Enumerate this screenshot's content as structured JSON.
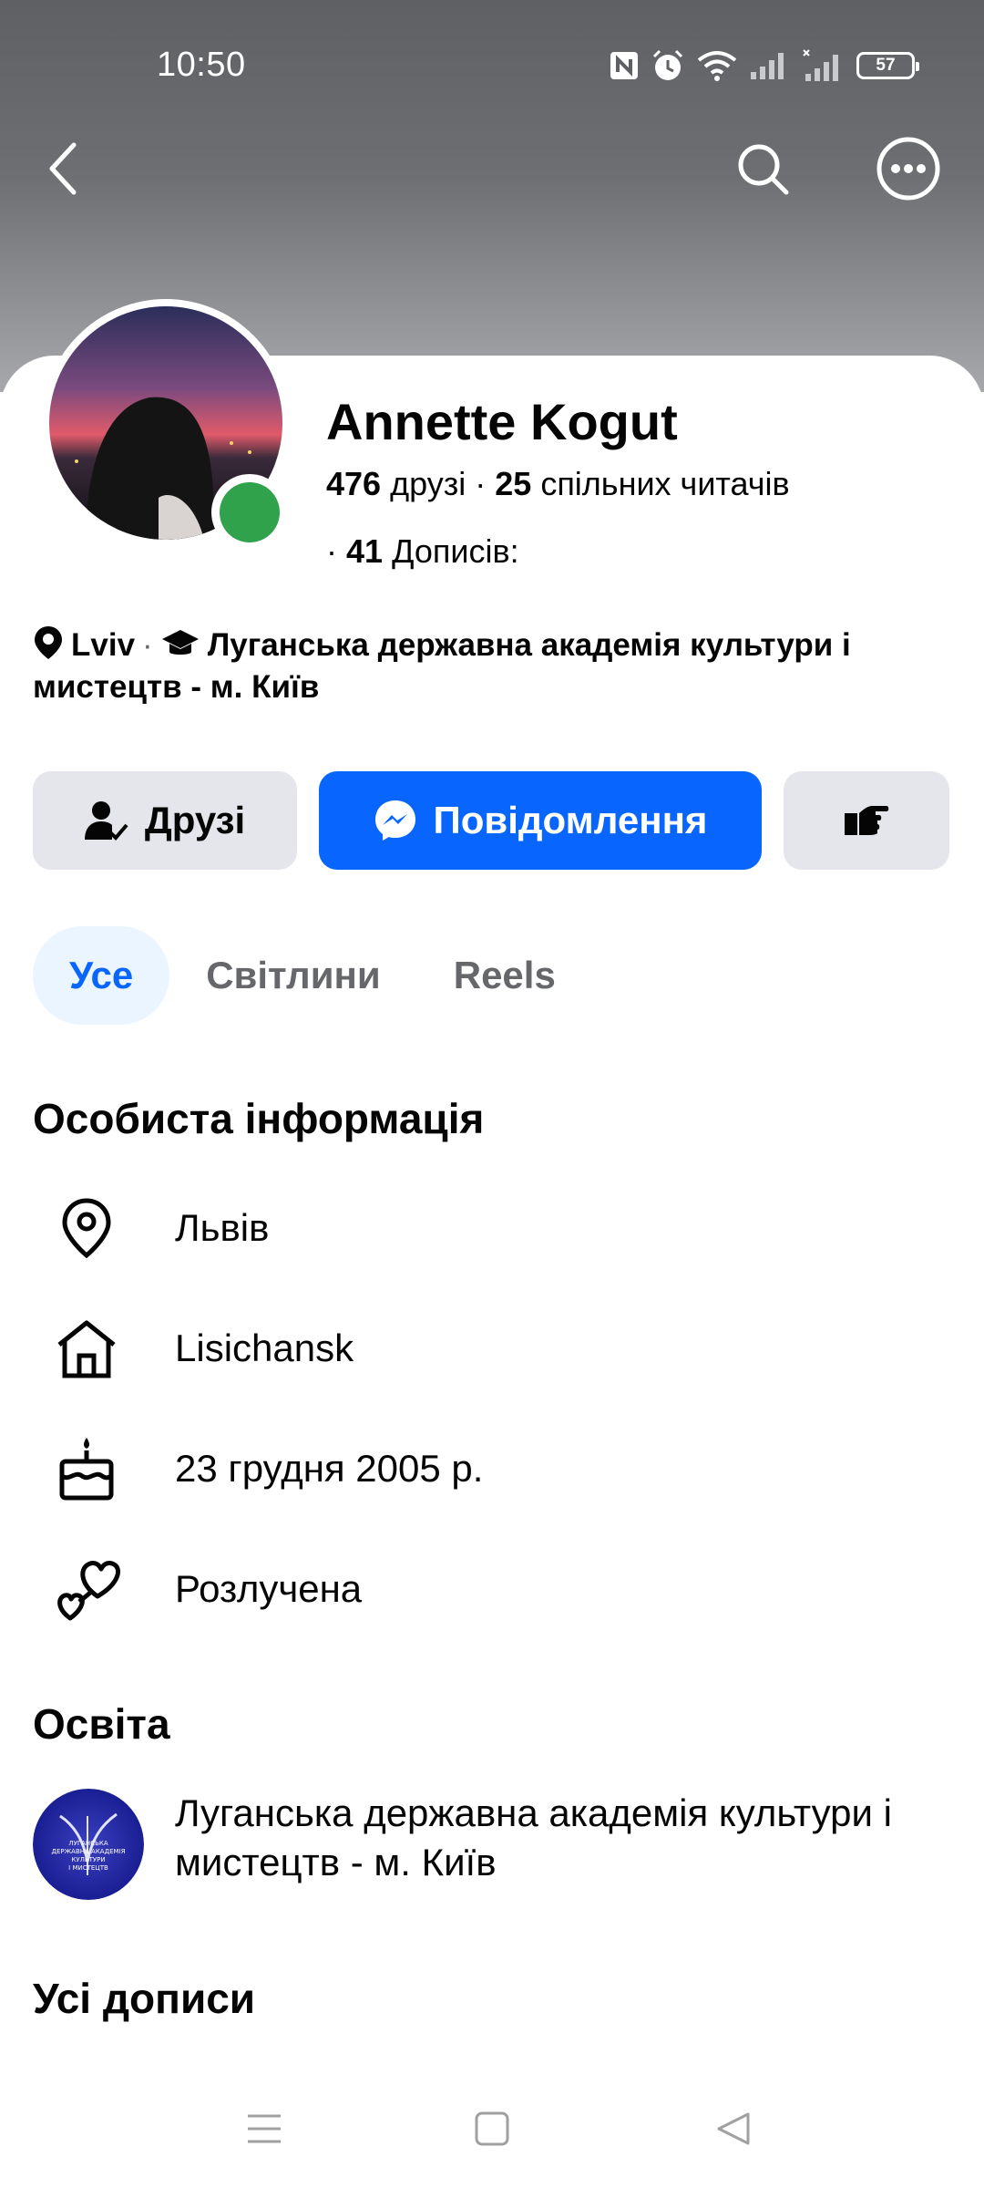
{
  "status_bar": {
    "time": "10:50",
    "battery": "57",
    "icons": [
      "nfc-icon",
      "alarm-icon",
      "wifi-icon",
      "signal-icon",
      "signal-icon"
    ]
  },
  "top_nav": {
    "back_icon": "back-arrow-icon",
    "search_icon": "search-icon",
    "more_icon": "more-options-icon"
  },
  "profile": {
    "name": "Annette Kogut",
    "friends_count": "476",
    "friends_label": "друзі",
    "followers_count": "25",
    "followers_label": "спільних читачів",
    "posts_count": "41",
    "posts_label": "Дописів:",
    "online": true
  },
  "intro": {
    "city": "Lviv",
    "education": "Луганська державна академія культури і мистецтв - м. Київ"
  },
  "actions": {
    "friends_label": "Друзі",
    "message_label": "Повідомлення",
    "more_icon": "poke-hand-icon"
  },
  "tabs": [
    {
      "label": "Усе",
      "active": true
    },
    {
      "label": "Світлини",
      "active": false
    },
    {
      "label": "Reels",
      "active": false
    }
  ],
  "personal_info": {
    "title": "Особиста інформація",
    "items": [
      {
        "icon": "location-pin-icon",
        "text": "Львів"
      },
      {
        "icon": "home-icon",
        "text": "Lisichansk"
      },
      {
        "icon": "birthday-cake-icon",
        "text": "23 грудня 2005 р."
      },
      {
        "icon": "relationship-hearts-icon",
        "text": "Розлучена"
      }
    ]
  },
  "education": {
    "title": "Освіта",
    "school": "Луганська державна академія культури і мистецтв - м. Київ",
    "logo_text": "ЛУГАНСЬКА ДЕРЖАВНА АКАДЕМІЯ КУЛЬТУРИ І МИСТЕЦТВ"
  },
  "posts": {
    "title": "Усі дописи"
  },
  "colors": {
    "accent": "#0866ff",
    "secondary_button": "#e4e6eb",
    "online": "#31a24c",
    "tab_active_bg": "#ebf5ff"
  }
}
